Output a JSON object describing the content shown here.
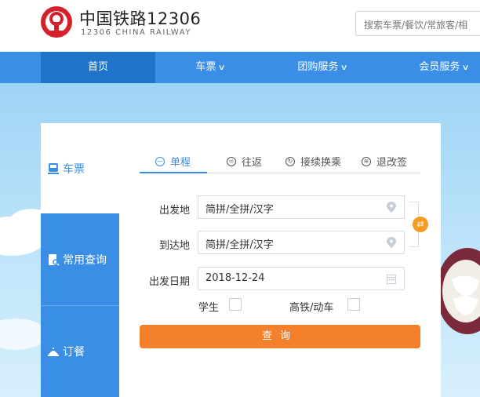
{
  "header": {
    "brand_title": "中国铁路12306",
    "brand_sub": "12306 CHINA RAILWAY",
    "search_placeholder": "搜索车票/餐饮/常旅客/相"
  },
  "nav": {
    "items": [
      {
        "label": "首页",
        "active": true,
        "dropdown": false
      },
      {
        "label": "车票",
        "active": false,
        "dropdown": true
      },
      {
        "label": "团购服务",
        "active": false,
        "dropdown": true
      },
      {
        "label": "会员服务",
        "active": false,
        "dropdown": true
      }
    ]
  },
  "sidebar": {
    "items": [
      {
        "label": "车票",
        "icon": "train-icon"
      },
      {
        "label": "常用查询",
        "icon": "document-search-icon"
      },
      {
        "label": "订餐",
        "icon": "food-cover-icon"
      }
    ]
  },
  "tabs": [
    {
      "label": "单程",
      "active": true
    },
    {
      "label": "往返",
      "active": false
    },
    {
      "label": "接续换乘",
      "active": false
    },
    {
      "label": "退改签",
      "active": false
    }
  ],
  "form": {
    "from_label": "出发地",
    "from_placeholder": "简拼/全拼/汉字",
    "to_label": "到达地",
    "to_placeholder": "简拼/全拼/汉字",
    "date_label": "出发日期",
    "date_value": "2018-12-24",
    "student_label": "学生",
    "highspeed_label": "高铁/动车",
    "query_label": "查询"
  },
  "colors": {
    "primary": "#3a8ee6",
    "nav_active": "#1f74c9",
    "accent": "#f5802b",
    "logo_red": "#d6202b"
  }
}
